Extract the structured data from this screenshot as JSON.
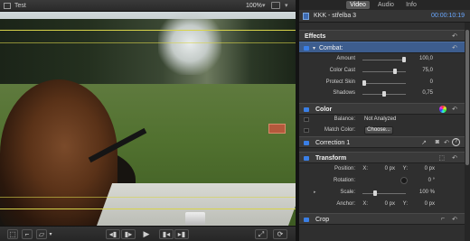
{
  "viewer": {
    "title": "Test",
    "zoom": "100%",
    "colors": {
      "guide": "#d8d34a",
      "target": "#b4593c"
    }
  },
  "inspector": {
    "tabs": [
      {
        "label": "Video",
        "active": true
      },
      {
        "label": "Audio",
        "active": false
      },
      {
        "label": "Info",
        "active": false
      }
    ],
    "clip_name": "KKK - střelba 3",
    "clip_duration": "00:00:10:19",
    "effects": {
      "label": "Effects",
      "combat": {
        "label": "Combat:",
        "amount_label": "Amount",
        "amount_value": "100,0",
        "color_cast_label": "Color Cast",
        "color_cast_value": "75,0",
        "protect_skin_label": "Protect Skin",
        "protect_skin_value": "0",
        "shadows_label": "Shadows",
        "shadows_value": "0,75"
      }
    },
    "color": {
      "label": "Color",
      "balance_label": "Balance:",
      "balance_value": "Not Analyzed",
      "match_color_label": "Match Color:",
      "choose_button": "Choose..."
    },
    "correction": {
      "label": "Correction 1"
    },
    "transform": {
      "label": "Transform",
      "position_label": "Position:",
      "position_x_label": "X:",
      "position_x": "0 px",
      "position_y_label": "Y:",
      "position_y": "0 px",
      "rotation_label": "Rotation:",
      "rotation_value": "0 °",
      "scale_label": "Scale:",
      "scale_value": "100 %",
      "anchor_label": "Anchor:",
      "anchor_x_label": "X:",
      "anchor_x": "0 px",
      "anchor_y_label": "Y:",
      "anchor_y": "0 px"
    },
    "crop": {
      "label": "Crop"
    },
    "colors": {
      "accent": "#3a7fe6",
      "timecode": "#6aa8ff",
      "selected_row": "#3d5d8e"
    }
  }
}
